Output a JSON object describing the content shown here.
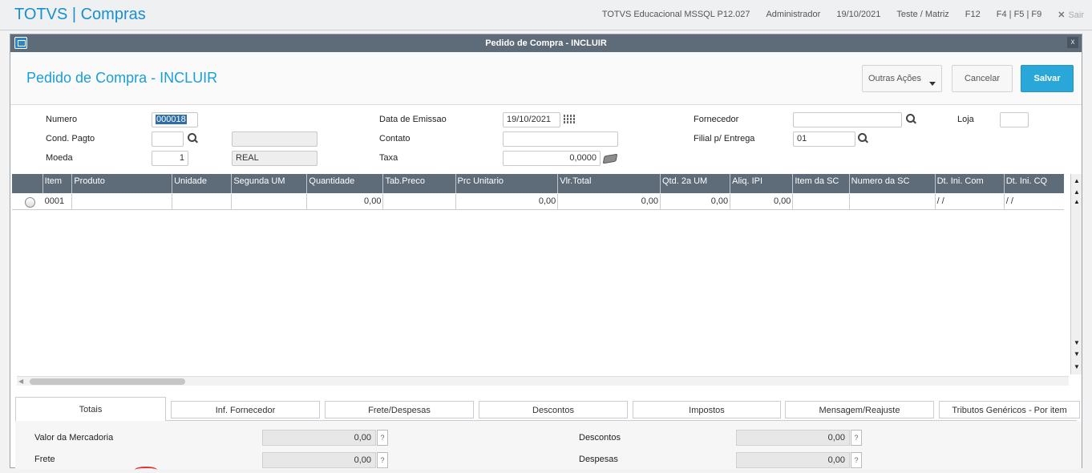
{
  "app": {
    "title": "TOTVS | Compras",
    "environment": "TOTVS Educacional MSSQL P12.027",
    "user": "Administrador",
    "date": "19/10/2021",
    "branch": "Teste / Matriz",
    "f12": "F12",
    "fkeys": "F4 | F5 | F9",
    "close_glyph": "✕",
    "exit_label": "Sair"
  },
  "window": {
    "title": "Pedido de Compra - INCLUIR",
    "close_glyph": "x",
    "page_title": "Pedido de Compra - INCLUIR",
    "buttons": {
      "outras": "Outras Ações",
      "cancelar": "Cancelar",
      "salvar": "Salvar"
    }
  },
  "form": {
    "numero_label": "Numero",
    "numero_value": "000018",
    "cond_label": "Cond. Pagto",
    "cond_value": "",
    "cond_desc": "",
    "moeda_label": "Moeda",
    "moeda_value": "1",
    "moeda_desc": "REAL",
    "data_label": "Data de Emissao",
    "data_value": "19/10/2021",
    "contato_label": "Contato",
    "contato_value": "",
    "taxa_label": "Taxa",
    "taxa_value": "0,0000",
    "fornecedor_label": "Fornecedor",
    "fornecedor_value": "",
    "loja_label": "Loja",
    "loja_value": "",
    "filial_label": "Filial p/ Entrega",
    "filial_value": "01"
  },
  "grid": {
    "columns": [
      "Item",
      "Produto",
      "Unidade",
      "Segunda UM",
      "Quantidade",
      "Tab.Preco",
      "Prc Unitario",
      "Vlr.Total",
      "Qtd. 2a UM",
      "Aliq. IPI",
      "Item da SC",
      "Numero da SC",
      "Dt. Ini. Com",
      "Dt. Ini. CQ"
    ],
    "row": [
      "0001",
      "",
      "",
      "",
      "0,00",
      "",
      "0,00",
      "0,00",
      "0,00",
      "0,00",
      "",
      "",
      " /  /",
      " /  /"
    ]
  },
  "tabs": [
    "Totais",
    "Inf. Fornecedor",
    "Frete/Despesas",
    "Descontos",
    "Impostos",
    "Mensagem/Reajuste",
    "Tributos Genéricos - Por item"
  ],
  "totais": {
    "valor_mercadoria_label": "Valor da Mercadoria",
    "valor_mercadoria": "0,00",
    "frete_label": "Frete",
    "frete": "0,00",
    "descontos_label": "Descontos",
    "descontos": "0,00",
    "despesas_label": "Despesas",
    "despesas": "0,00",
    "help_glyph": "?"
  }
}
